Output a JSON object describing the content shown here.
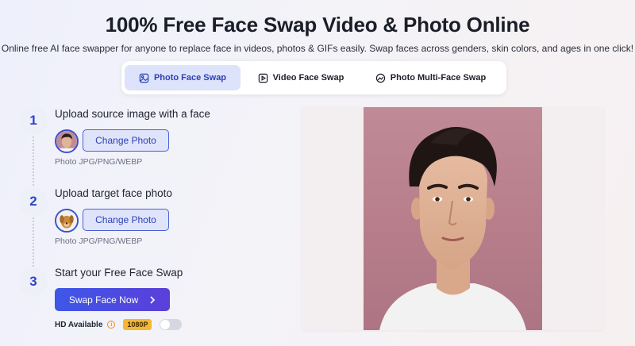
{
  "header": {
    "title": "100% Free Face Swap Video & Photo Online",
    "subtitle": "Online free AI face swapper for anyone to replace face in videos, photos & GIFs easily. Swap faces across genders, skin colors, and ages in one click!"
  },
  "tabs": [
    {
      "label": "Photo Face Swap",
      "active": true,
      "icon": "image-icon"
    },
    {
      "label": "Video Face Swap",
      "active": false,
      "icon": "video-play-icon"
    },
    {
      "label": "Photo Multi-Face Swap",
      "active": false,
      "icon": "multi-face-icon"
    }
  ],
  "steps": [
    {
      "number": "1",
      "title": "Upload source image with a face",
      "button": "Change Photo",
      "hint": "Photo JPG/PNG/WEBP"
    },
    {
      "number": "2",
      "title": "Upload target face photo",
      "button": "Change Photo",
      "hint": "Photo JPG/PNG/WEBP"
    },
    {
      "number": "3",
      "title": "Start your Free Face Swap"
    }
  ],
  "swap": {
    "button": "Swap Face Now",
    "icon": "chevron-right-icon"
  },
  "hd": {
    "label": "HD Available",
    "badge": "1080P",
    "enabled": false
  },
  "colors": {
    "accent": "#3d57e8",
    "accent_dark": "#2c3fb8",
    "tab_active_bg": "#dde3fa",
    "badge": "#f7b733"
  }
}
